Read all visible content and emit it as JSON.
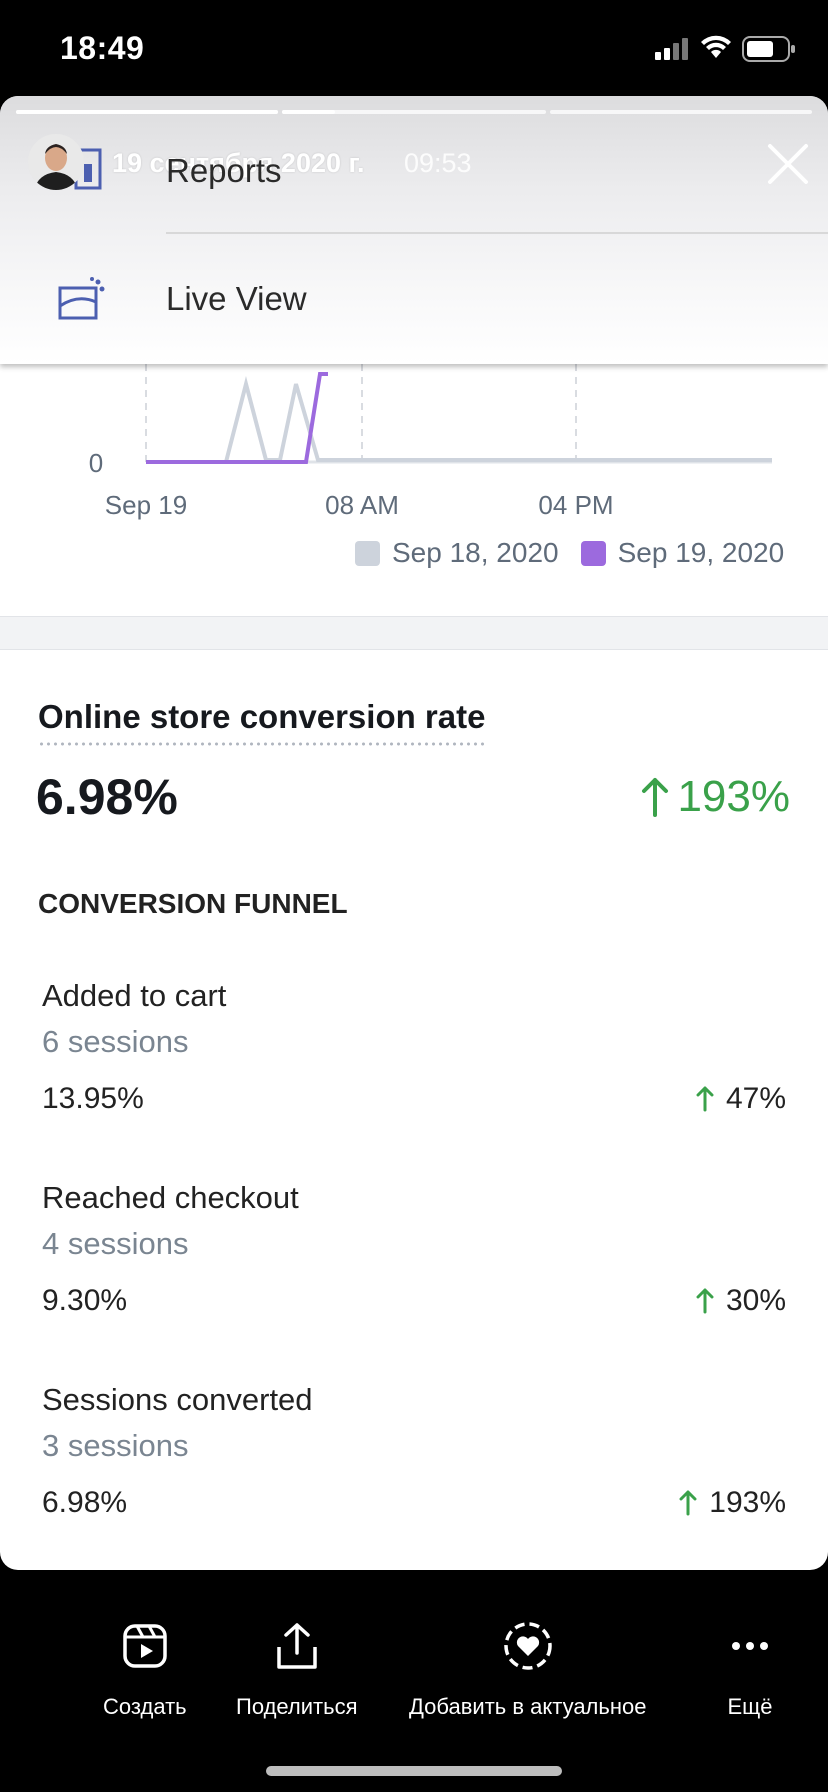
{
  "status_bar": {
    "time": "18:49"
  },
  "story": {
    "date": "19 сентября 2020 г.",
    "time": "09:53",
    "progress_segments": [
      1.0,
      0.2,
      0.0
    ]
  },
  "menu": {
    "items": [
      {
        "label": "Reports",
        "icon": "reports-icon"
      },
      {
        "label": "Live View",
        "icon": "live-view-icon"
      }
    ]
  },
  "chart_data": {
    "type": "line",
    "x_ticks": [
      "Sep 19",
      "08 AM",
      "04 PM"
    ],
    "y_ticks": [
      "0"
    ],
    "series": [
      {
        "name": "Sep 18, 2020",
        "color": "#cdd3dc"
      },
      {
        "name": "Sep 19, 2020",
        "color": "#9c6ade"
      }
    ]
  },
  "metric": {
    "title": "Online store conversion rate",
    "value": "6.98%",
    "change": "193%",
    "change_color": "#3aa14a"
  },
  "funnel": {
    "heading": "CONVERSION FUNNEL",
    "rows": [
      {
        "label": "Added to cart",
        "sessions": "6 sessions",
        "rate": "13.95%",
        "change": "47%"
      },
      {
        "label": "Reached checkout",
        "sessions": "4 sessions",
        "rate": "9.30%",
        "change": "30%"
      },
      {
        "label": "Sessions converted",
        "sessions": "3 sessions",
        "rate": "6.98%",
        "change": "193%"
      }
    ]
  },
  "bottom_bar": {
    "items": [
      {
        "label": "Создать",
        "icon": "reels-icon"
      },
      {
        "label": "Поделиться",
        "icon": "share-icon"
      },
      {
        "label": "Добавить в актуальное",
        "icon": "highlight-heart-icon"
      },
      {
        "label": "Ещё",
        "icon": "more-icon"
      }
    ]
  }
}
